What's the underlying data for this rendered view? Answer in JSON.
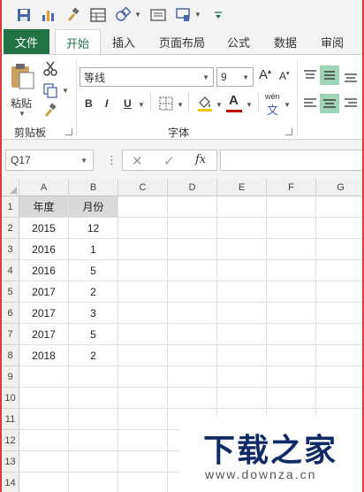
{
  "ribbon_tabs": {
    "file": "文件",
    "home": "开始",
    "insert": "插入",
    "page_layout": "页面布局",
    "formulas": "公式",
    "data": "数据",
    "review": "审阅"
  },
  "clipboard": {
    "paste": "粘贴",
    "group_label": "剪贴板"
  },
  "font": {
    "name": "等线",
    "size": "9",
    "group_label": "字体",
    "bold": "B",
    "italic": "I",
    "underline": "U",
    "phonetic": "wén"
  },
  "formula_bar": {
    "name_box": "Q17",
    "fx": "fx",
    "value": ""
  },
  "sheet": {
    "columns": [
      "A",
      "B",
      "C",
      "D",
      "E",
      "F",
      "G"
    ],
    "rows": [
      "1",
      "2",
      "3",
      "4",
      "5",
      "6",
      "7",
      "8",
      "9",
      "10",
      "11",
      "12",
      "13",
      "14"
    ],
    "headers": [
      "年度",
      "月份"
    ],
    "data": [
      [
        "2015",
        "12"
      ],
      [
        "2016",
        "1"
      ],
      [
        "2016",
        "5"
      ],
      [
        "2017",
        "2"
      ],
      [
        "2017",
        "3"
      ],
      [
        "2017",
        "5"
      ],
      [
        "2018",
        "2"
      ]
    ]
  },
  "watermark": {
    "title": "下载之家",
    "url": "www.downza.cn"
  },
  "colors": {
    "accent": "#217346",
    "frame": "#e23a3a",
    "font_color": "#c00000",
    "watermark": "#0f2a66"
  }
}
